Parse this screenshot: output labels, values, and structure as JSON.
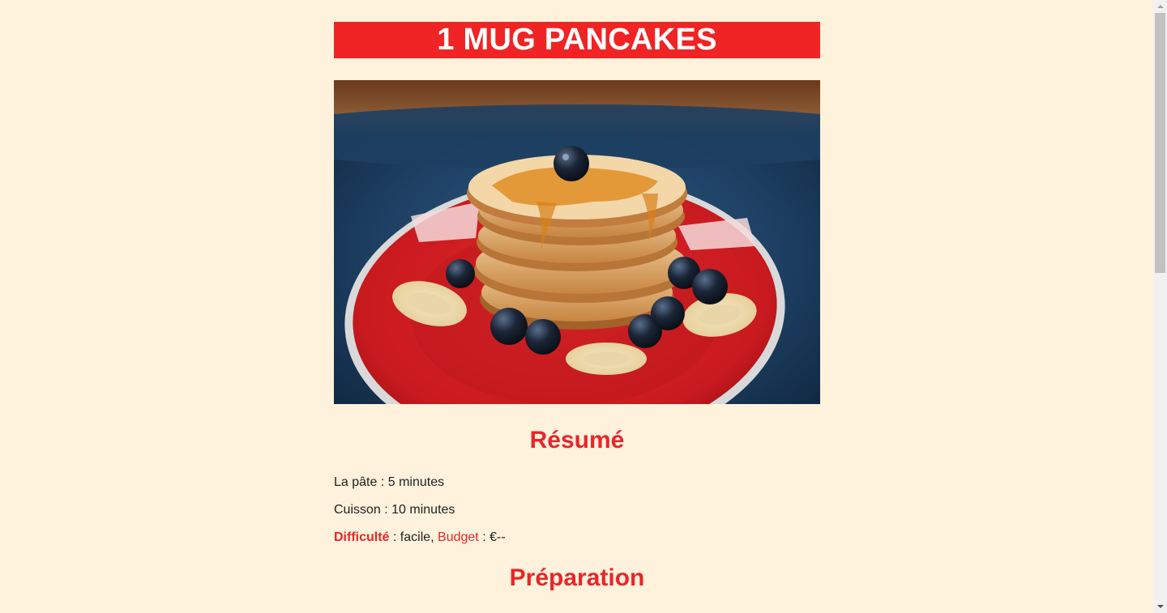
{
  "title": "1 MUG PANCAKES",
  "hero_image": {
    "icon": "pancake-stack-photo"
  },
  "summary": {
    "heading": "Résumé",
    "dough_label": "La pâte",
    "dough_value": " : 5 minutes",
    "cooking_label": "Cuisson",
    "cooking_value": " : 10 minutes",
    "difficulty_label": "Difficulté",
    "difficulty_value": " : facile, ",
    "budget_label": "Budget",
    "budget_value": " : €--"
  },
  "preparation": {
    "heading": "Préparation"
  },
  "colors": {
    "background": "#fef2dc",
    "accent": "#e8262b",
    "title_bar": "#f02424"
  }
}
